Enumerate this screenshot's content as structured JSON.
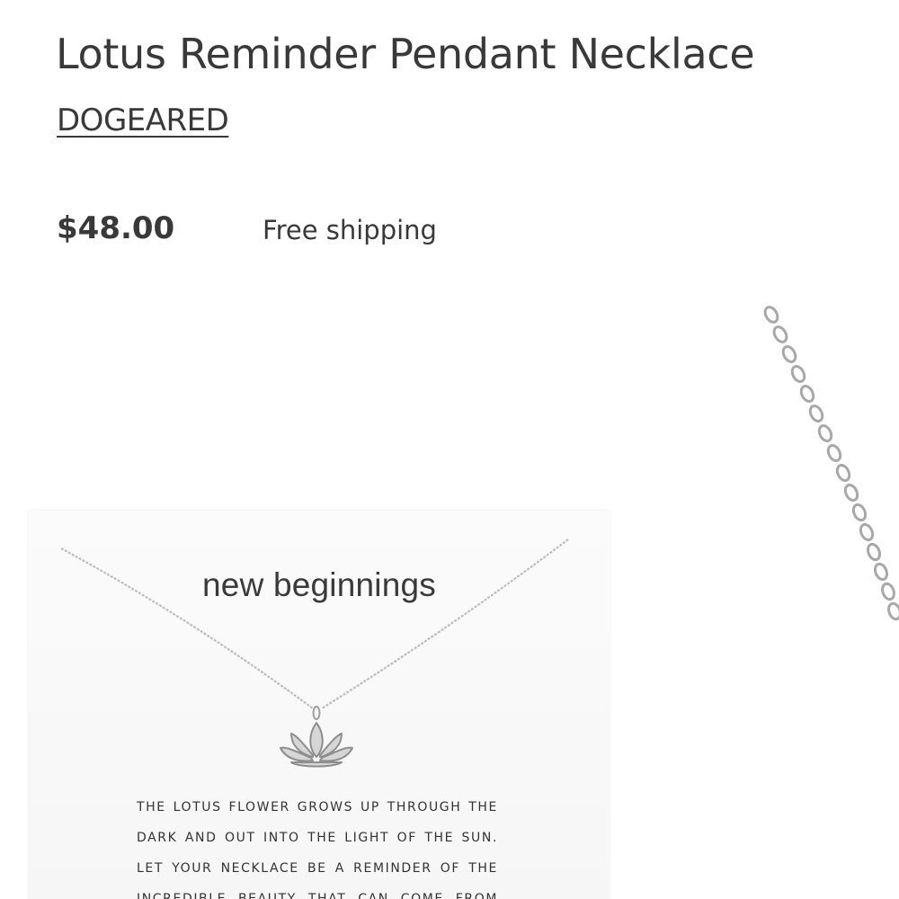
{
  "product": {
    "title": "Lotus Reminder Pendant Necklace",
    "brand": "DOGEARED",
    "price": "$48.00",
    "shipping": "Free shipping"
  },
  "gallery": {
    "image": {
      "card_heading": "new beginnings",
      "card_text_lines": [
        "THE LOTUS FLOWER GROWS UP THROUGH THE",
        "DARK AND OUT INTO THE LIGHT OF THE SUN.",
        "LET YOUR NECKLACE BE A REMINDER OF THE",
        "INCREDIBLE BEAUTY THAT CAN COME FROM"
      ]
    },
    "next_image_icon": "chain-close-up-image"
  },
  "colors": {
    "text": "#393939",
    "background": "#ffffff",
    "silver": "#b9b9b9"
  }
}
